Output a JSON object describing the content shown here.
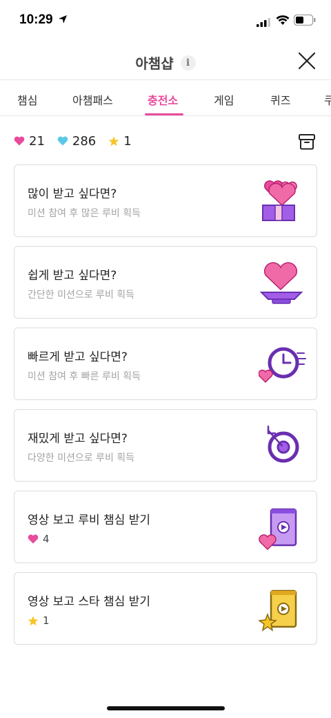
{
  "status_bar": {
    "time": "10:29"
  },
  "header": {
    "title": "아챔샵",
    "info_glyph": "i"
  },
  "tabs": [
    {
      "label": "챔심",
      "active": false
    },
    {
      "label": "아챔패스",
      "active": false
    },
    {
      "label": "충전소",
      "active": true
    },
    {
      "label": "게임",
      "active": false
    },
    {
      "label": "퀴즈",
      "active": false
    },
    {
      "label": "쿠",
      "active": false
    }
  ],
  "balances": {
    "ruby": {
      "value": "21",
      "color": "#e84a9c"
    },
    "diamond": {
      "value": "286",
      "color": "#5bc8e6"
    },
    "star": {
      "value": "1",
      "color": "#f6c528"
    }
  },
  "cards": [
    {
      "title": "많이 받고 싶다면?",
      "subtitle": "미션 참여 후 많은 루비 획득",
      "icon": "gift-hearts-icon"
    },
    {
      "title": "쉽게 받고 싶다면?",
      "subtitle": "간단한 미션으로 루비 획득",
      "icon": "heart-plate-icon"
    },
    {
      "title": "빠르게 받고 싶다면?",
      "subtitle": "미션 참여 후 빠른 루비 획득",
      "icon": "fast-clock-icon"
    },
    {
      "title": "재밌게 받고 싶다면?",
      "subtitle": "다양한 미션으로 루비 획득",
      "icon": "target-icon"
    },
    {
      "title": "영상 보고 루비 챔심 받기",
      "reward": "4",
      "icon": "video-phone-heart-icon"
    },
    {
      "title": "영상 보고 스타 챔심 받기",
      "reward": "1",
      "icon": "video-phone-star-icon"
    }
  ],
  "colors": {
    "accent": "#e84a9c",
    "purple": "#8a4fe0",
    "border": "#dcdcdc"
  }
}
